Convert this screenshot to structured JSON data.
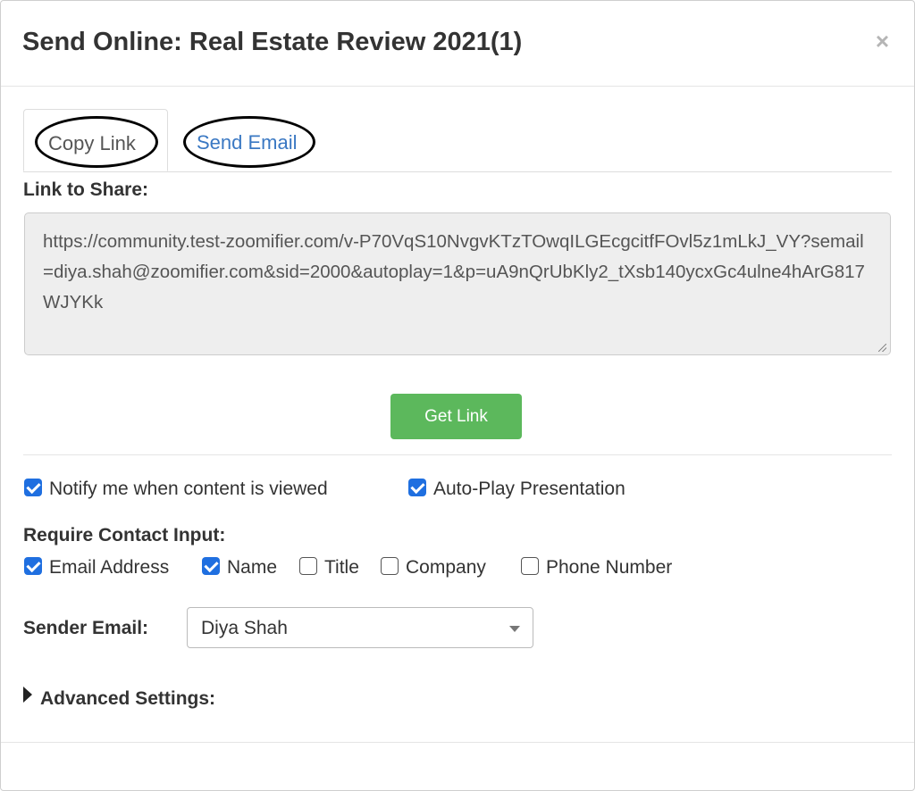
{
  "dialog": {
    "title": "Send Online: Real Estate Review 2021(1)",
    "close_symbol": "×"
  },
  "tabs": [
    {
      "label": "Copy Link",
      "active": true
    },
    {
      "label": "Send Email",
      "active": false
    }
  ],
  "link_section": {
    "label": "Link to Share:",
    "url": "https://community.test-zoomifier.com/v-P70VqS10NvgvKTzTOwqILGEcgcitfFOvl5z1mLkJ_VY?semail=diya.shah@zoomifier.com&sid=2000&autoplay=1&p=uA9nQrUbKly2_tXsb140ycxGc4ulne4hArG817WJYKk"
  },
  "get_link_button": "Get Link",
  "options": [
    {
      "label": "Notify me when content is viewed",
      "checked": true
    },
    {
      "label": "Auto-Play Presentation",
      "checked": true
    }
  ],
  "contact_input": {
    "label": "Require Contact Input:",
    "items": [
      {
        "label": "Email Address",
        "checked": true
      },
      {
        "label": "Name",
        "checked": true
      },
      {
        "label": "Title",
        "checked": false
      },
      {
        "label": "Company",
        "checked": false
      },
      {
        "label": "Phone Number",
        "checked": false
      }
    ]
  },
  "sender": {
    "label": "Sender Email:",
    "selected": "Diya Shah"
  },
  "advanced": {
    "label": "Advanced Settings:"
  },
  "colors": {
    "accent_link": "#3a78c3",
    "button_green": "#5cb85c",
    "checkbox_blue": "#1f6fe0"
  },
  "icons": {
    "close": "close-icon",
    "checkbox": "checkbox-icon",
    "dropdown": "chevron-down-icon",
    "disclosure": "triangle-right-icon"
  }
}
